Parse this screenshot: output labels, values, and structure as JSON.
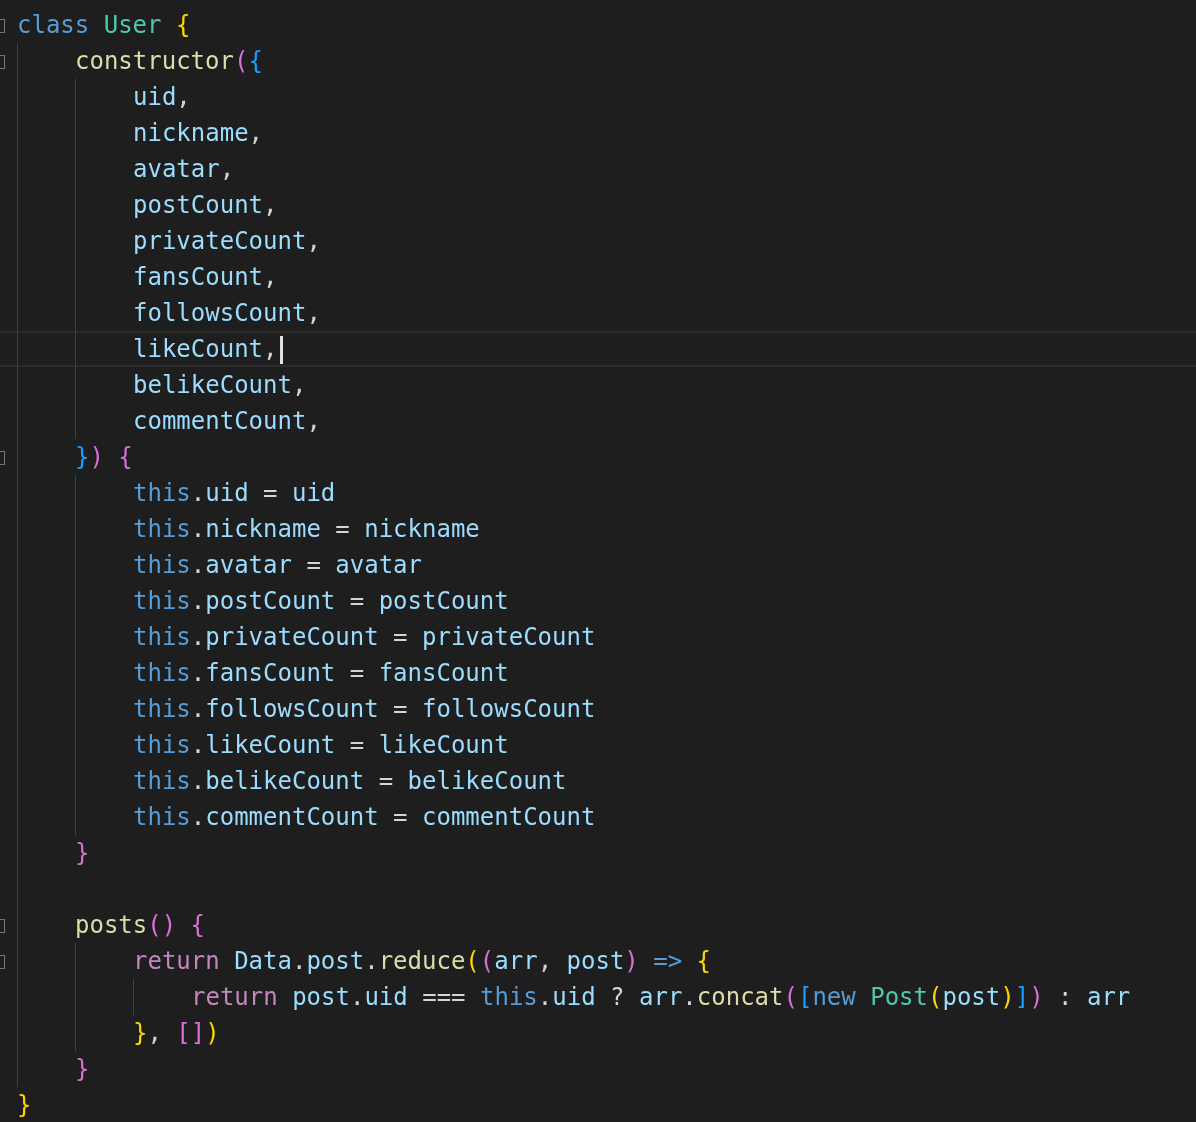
{
  "editor": {
    "lines": [
      {
        "fold_marker": true,
        "current": false,
        "tokens": [
          {
            "text": "class ",
            "kind": "keyword"
          },
          {
            "text": "User ",
            "kind": "type"
          },
          {
            "text": "{",
            "kind": "bracket1"
          }
        ]
      },
      {
        "fold_marker": true,
        "current": false,
        "tokens": [
          {
            "text": "    constructor",
            "kind": "function"
          },
          {
            "text": "(",
            "kind": "bracket2"
          },
          {
            "text": "{",
            "kind": "bracket3"
          }
        ]
      },
      {
        "fold_marker": false,
        "current": false,
        "tokens": [
          {
            "text": "        uid",
            "kind": "variable"
          },
          {
            "text": ",",
            "kind": "punct"
          }
        ]
      },
      {
        "fold_marker": false,
        "current": false,
        "tokens": [
          {
            "text": "        nickname",
            "kind": "variable"
          },
          {
            "text": ",",
            "kind": "punct"
          }
        ]
      },
      {
        "fold_marker": false,
        "current": false,
        "tokens": [
          {
            "text": "        avatar",
            "kind": "variable"
          },
          {
            "text": ",",
            "kind": "punct"
          }
        ]
      },
      {
        "fold_marker": false,
        "current": false,
        "tokens": [
          {
            "text": "        postCount",
            "kind": "variable"
          },
          {
            "text": ",",
            "kind": "punct"
          }
        ]
      },
      {
        "fold_marker": false,
        "current": false,
        "tokens": [
          {
            "text": "        privateCount",
            "kind": "variable"
          },
          {
            "text": ",",
            "kind": "punct"
          }
        ]
      },
      {
        "fold_marker": false,
        "current": false,
        "tokens": [
          {
            "text": "        fansCount",
            "kind": "variable"
          },
          {
            "text": ",",
            "kind": "punct"
          }
        ]
      },
      {
        "fold_marker": false,
        "current": false,
        "tokens": [
          {
            "text": "        followsCount",
            "kind": "variable"
          },
          {
            "text": ",",
            "kind": "punct"
          }
        ]
      },
      {
        "fold_marker": false,
        "current": true,
        "tokens": [
          {
            "text": "        likeCount",
            "kind": "variable"
          },
          {
            "text": ",",
            "kind": "punct"
          }
        ]
      },
      {
        "fold_marker": false,
        "current": false,
        "tokens": [
          {
            "text": "        belikeCount",
            "kind": "variable"
          },
          {
            "text": ",",
            "kind": "punct"
          }
        ]
      },
      {
        "fold_marker": false,
        "current": false,
        "tokens": [
          {
            "text": "        commentCount",
            "kind": "variable"
          },
          {
            "text": ",",
            "kind": "punct"
          }
        ]
      },
      {
        "fold_marker": true,
        "current": false,
        "tokens": [
          {
            "text": "    }",
            "kind": "bracket3"
          },
          {
            "text": ") ",
            "kind": "bracket2"
          },
          {
            "text": "{",
            "kind": "bracket2"
          }
        ]
      },
      {
        "fold_marker": false,
        "current": false,
        "tokens": [
          {
            "text": "        this",
            "kind": "keyword"
          },
          {
            "text": ".",
            "kind": "punct"
          },
          {
            "text": "uid",
            "kind": "variable"
          },
          {
            "text": " = ",
            "kind": "punct"
          },
          {
            "text": "uid",
            "kind": "variable"
          }
        ]
      },
      {
        "fold_marker": false,
        "current": false,
        "tokens": [
          {
            "text": "        this",
            "kind": "keyword"
          },
          {
            "text": ".",
            "kind": "punct"
          },
          {
            "text": "nickname",
            "kind": "variable"
          },
          {
            "text": " = ",
            "kind": "punct"
          },
          {
            "text": "nickname",
            "kind": "variable"
          }
        ]
      },
      {
        "fold_marker": false,
        "current": false,
        "tokens": [
          {
            "text": "        this",
            "kind": "keyword"
          },
          {
            "text": ".",
            "kind": "punct"
          },
          {
            "text": "avatar",
            "kind": "variable"
          },
          {
            "text": " = ",
            "kind": "punct"
          },
          {
            "text": "avatar",
            "kind": "variable"
          }
        ]
      },
      {
        "fold_marker": false,
        "current": false,
        "tokens": [
          {
            "text": "        this",
            "kind": "keyword"
          },
          {
            "text": ".",
            "kind": "punct"
          },
          {
            "text": "postCount",
            "kind": "variable"
          },
          {
            "text": " = ",
            "kind": "punct"
          },
          {
            "text": "postCount",
            "kind": "variable"
          }
        ]
      },
      {
        "fold_marker": false,
        "current": false,
        "tokens": [
          {
            "text": "        this",
            "kind": "keyword"
          },
          {
            "text": ".",
            "kind": "punct"
          },
          {
            "text": "privateCount",
            "kind": "variable"
          },
          {
            "text": " = ",
            "kind": "punct"
          },
          {
            "text": "privateCount",
            "kind": "variable"
          }
        ]
      },
      {
        "fold_marker": false,
        "current": false,
        "tokens": [
          {
            "text": "        this",
            "kind": "keyword"
          },
          {
            "text": ".",
            "kind": "punct"
          },
          {
            "text": "fansCount",
            "kind": "variable"
          },
          {
            "text": " = ",
            "kind": "punct"
          },
          {
            "text": "fansCount",
            "kind": "variable"
          }
        ]
      },
      {
        "fold_marker": false,
        "current": false,
        "tokens": [
          {
            "text": "        this",
            "kind": "keyword"
          },
          {
            "text": ".",
            "kind": "punct"
          },
          {
            "text": "followsCount",
            "kind": "variable"
          },
          {
            "text": " = ",
            "kind": "punct"
          },
          {
            "text": "followsCount",
            "kind": "variable"
          }
        ]
      },
      {
        "fold_marker": false,
        "current": false,
        "tokens": [
          {
            "text": "        this",
            "kind": "keyword"
          },
          {
            "text": ".",
            "kind": "punct"
          },
          {
            "text": "likeCount",
            "kind": "variable"
          },
          {
            "text": " = ",
            "kind": "punct"
          },
          {
            "text": "likeCount",
            "kind": "variable"
          }
        ]
      },
      {
        "fold_marker": false,
        "current": false,
        "tokens": [
          {
            "text": "        this",
            "kind": "keyword"
          },
          {
            "text": ".",
            "kind": "punct"
          },
          {
            "text": "belikeCount",
            "kind": "variable"
          },
          {
            "text": " = ",
            "kind": "punct"
          },
          {
            "text": "belikeCount",
            "kind": "variable"
          }
        ]
      },
      {
        "fold_marker": false,
        "current": false,
        "tokens": [
          {
            "text": "        this",
            "kind": "keyword"
          },
          {
            "text": ".",
            "kind": "punct"
          },
          {
            "text": "commentCount",
            "kind": "variable"
          },
          {
            "text": " = ",
            "kind": "punct"
          },
          {
            "text": "commentCount",
            "kind": "variable"
          }
        ]
      },
      {
        "fold_marker": false,
        "current": false,
        "tokens": [
          {
            "text": "    }",
            "kind": "bracket2"
          }
        ]
      },
      {
        "fold_marker": false,
        "current": false
      },
      {
        "fold_marker": true,
        "current": false,
        "tokens": [
          {
            "text": "    posts",
            "kind": "function"
          },
          {
            "text": "() ",
            "kind": "bracket2"
          },
          {
            "text": "{",
            "kind": "bracket2"
          }
        ]
      },
      {
        "fold_marker": true,
        "current": false,
        "tokens": [
          {
            "text": "        return ",
            "kind": "control"
          },
          {
            "text": "Data",
            "kind": "variable"
          },
          {
            "text": ".",
            "kind": "punct"
          },
          {
            "text": "post",
            "kind": "variable"
          },
          {
            "text": ".",
            "kind": "punct"
          },
          {
            "text": "reduce",
            "kind": "function"
          },
          {
            "text": "(",
            "kind": "bracket1"
          },
          {
            "text": "(",
            "kind": "bracket2"
          },
          {
            "text": "arr",
            "kind": "variable"
          },
          {
            "text": ", ",
            "kind": "punct"
          },
          {
            "text": "post",
            "kind": "variable"
          },
          {
            "text": ") ",
            "kind": "bracket2"
          },
          {
            "text": "=> ",
            "kind": "keyword"
          },
          {
            "text": "{",
            "kind": "bracket1"
          }
        ]
      },
      {
        "fold_marker": false,
        "current": false,
        "tokens": [
          {
            "text": "            return ",
            "kind": "control"
          },
          {
            "text": "post",
            "kind": "variable"
          },
          {
            "text": ".",
            "kind": "punct"
          },
          {
            "text": "uid",
            "kind": "variable"
          },
          {
            "text": " === ",
            "kind": "punct"
          },
          {
            "text": "this",
            "kind": "keyword"
          },
          {
            "text": ".",
            "kind": "punct"
          },
          {
            "text": "uid",
            "kind": "variable"
          },
          {
            "text": " ? ",
            "kind": "punct"
          },
          {
            "text": "arr",
            "kind": "variable"
          },
          {
            "text": ".",
            "kind": "punct"
          },
          {
            "text": "concat",
            "kind": "function"
          },
          {
            "text": "(",
            "kind": "bracket2"
          },
          {
            "text": "[",
            "kind": "bracket3"
          },
          {
            "text": "new ",
            "kind": "keyword"
          },
          {
            "text": "Post",
            "kind": "type"
          },
          {
            "text": "(",
            "kind": "bracket1"
          },
          {
            "text": "post",
            "kind": "variable"
          },
          {
            "text": ")",
            "kind": "bracket1"
          },
          {
            "text": "]",
            "kind": "bracket3"
          },
          {
            "text": ")",
            "kind": "bracket2"
          },
          {
            "text": " : ",
            "kind": "punct"
          },
          {
            "text": "arr",
            "kind": "variable"
          }
        ]
      },
      {
        "fold_marker": false,
        "current": false,
        "tokens": [
          {
            "text": "        }",
            "kind": "bracket1"
          },
          {
            "text": ", ",
            "kind": "punct"
          },
          {
            "text": "[]",
            "kind": "bracket2"
          },
          {
            "text": ")",
            "kind": "bracket1"
          }
        ]
      },
      {
        "fold_marker": false,
        "current": false,
        "tokens": [
          {
            "text": "    }",
            "kind": "bracket2"
          }
        ]
      },
      {
        "fold_marker": false,
        "current": false,
        "tokens": [
          {
            "text": "}",
            "kind": "bracket1"
          }
        ]
      }
    ]
  }
}
